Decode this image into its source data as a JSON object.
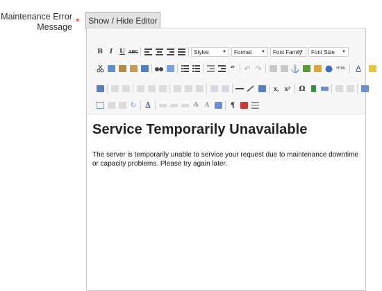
{
  "field": {
    "label": "Maintenance Error Message",
    "required_mark": "*"
  },
  "editor_toggle": {
    "label": "Show / Hide Editor"
  },
  "toolbar": {
    "row1": {
      "bold": "B",
      "italic": "I",
      "underline": "U",
      "strikethrough": "ABC",
      "styles": "Styles",
      "format": "Format",
      "font_family": "Font Family",
      "font_size": "Font Size"
    },
    "row2": {
      "html_label": "HTML"
    },
    "row3": {
      "subscript": "x,",
      "superscript": "x²",
      "omega": "Ω"
    },
    "row4": {
      "pilcrow": "¶"
    }
  },
  "content": {
    "heading": "Service Temporarily Unavailable",
    "paragraph": "The server is temporarily unable to service your request due to maintenance downtime or capacity problems. Please try again later."
  },
  "colors": {
    "required": "#e02b27",
    "toolbar_bg": "#f7f7f7",
    "button_bg": "#e3e3e3"
  }
}
